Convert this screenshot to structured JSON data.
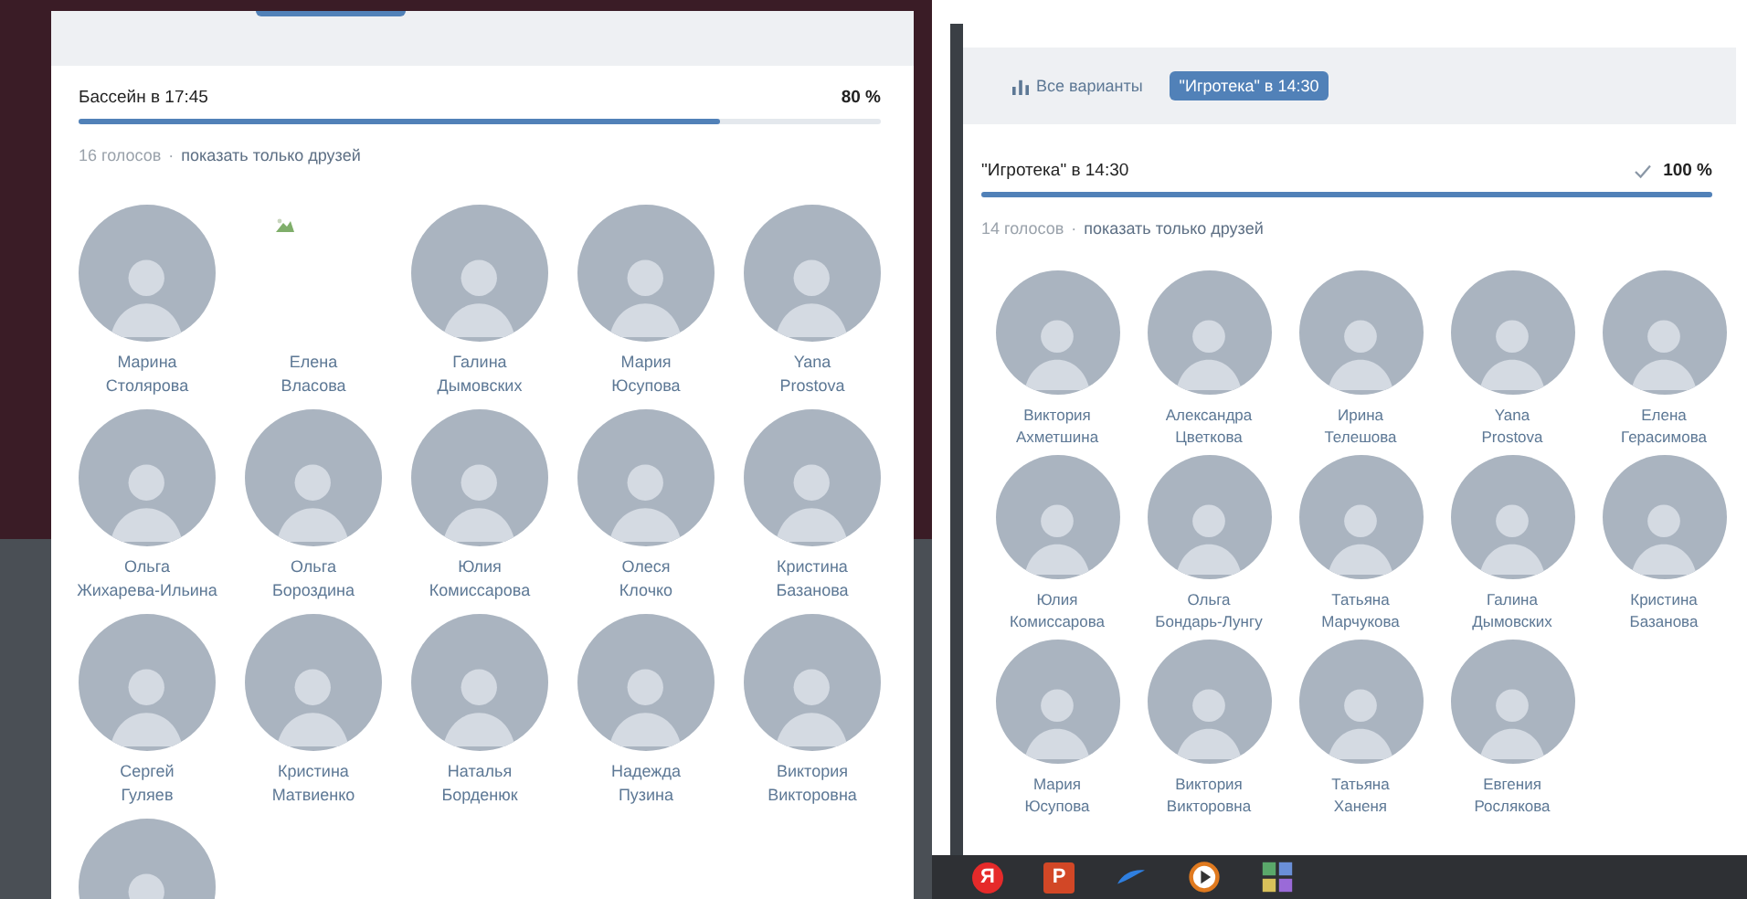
{
  "left_panel": {
    "option": {
      "title": "Бассейн в 17:45",
      "percent": "80 %",
      "level": 0.8,
      "checked": false
    },
    "votes": {
      "count": "16 голосов",
      "separator": "·",
      "friends_link": "показать только друзей"
    },
    "voters": [
      {
        "first": "Марина",
        "last": "Столярова",
        "has_photo": true
      },
      {
        "first": "Елена",
        "last": "Власова",
        "has_photo": false
      },
      {
        "first": "Галина",
        "last": "Дымовских",
        "has_photo": true
      },
      {
        "first": "Мария",
        "last": "Юсупова",
        "has_photo": true
      },
      {
        "first": "Yana",
        "last": "Prostova",
        "has_photo": true
      },
      {
        "first": "Ольга",
        "last": "Жихарева-Ильина",
        "has_photo": true
      },
      {
        "first": "Ольга",
        "last": "Бороздина",
        "has_photo": true
      },
      {
        "first": "Юлия",
        "last": "Комиссарова",
        "has_photo": true
      },
      {
        "first": "Олеся",
        "last": "Клочко",
        "has_photo": true
      },
      {
        "first": "Кристина",
        "last": "Базанова",
        "has_photo": true
      },
      {
        "first": "Сергей",
        "last": "Гуляев",
        "has_photo": true
      },
      {
        "first": "Кристина",
        "last": "Матвиенко",
        "has_photo": true
      },
      {
        "first": "Наталья",
        "last": "Борденюк",
        "has_photo": true
      },
      {
        "first": "Надежда",
        "last": "Пузина",
        "has_photo": true
      },
      {
        "first": "Виктория",
        "last": "Викторовна",
        "has_photo": true
      },
      {
        "has_photo": true
      }
    ]
  },
  "right_panel": {
    "tabs": [
      {
        "label": "Все варианты",
        "selected": false
      },
      {
        "label": "\"Игротека\" в 14:30",
        "selected": true
      }
    ],
    "option": {
      "title": "\"Игротека\" в 14:30",
      "percent": "100 %",
      "level": 1.0,
      "checked": true
    },
    "votes": {
      "count": "14 голосов",
      "separator": "·",
      "friends_link": "показать только друзей"
    },
    "voters": [
      {
        "first": "Виктория",
        "last": "Ахметшина",
        "has_photo": true
      },
      {
        "first": "Александра",
        "last": "Цветкова",
        "has_photo": true
      },
      {
        "first": "Ирина",
        "last": "Телешова",
        "has_photo": true
      },
      {
        "first": "Yana",
        "last": "Prostova",
        "has_photo": true
      },
      {
        "first": "Елена",
        "last": "Герасимова",
        "has_photo": true
      },
      {
        "first": "Юлия",
        "last": "Комиссарова",
        "has_photo": true
      },
      {
        "first": "Ольга",
        "last": "Бондарь-Лунгу",
        "has_photo": true
      },
      {
        "first": "Татьяна",
        "last": "Марчукова",
        "has_photo": true
      },
      {
        "first": "Галина",
        "last": "Дымовских",
        "has_photo": true
      },
      {
        "first": "Кристина",
        "last": "Базанова",
        "has_photo": true
      },
      {
        "first": "Мария",
        "last": "Юсупова",
        "has_photo": true
      },
      {
        "first": "Виктория",
        "last": "Викторовна",
        "has_photo": true
      },
      {
        "first": "Татьяна",
        "last": "Ханеня",
        "has_photo": true
      },
      {
        "first": "Евгения",
        "last": "Рослякова",
        "has_photo": true
      }
    ]
  },
  "taskbar": [
    {
      "kind": "yandex",
      "label": "Я"
    },
    {
      "kind": "powerpoint",
      "label": "P"
    },
    {
      "kind": "swoosh"
    },
    {
      "kind": "player"
    },
    {
      "kind": "tiles"
    }
  ]
}
